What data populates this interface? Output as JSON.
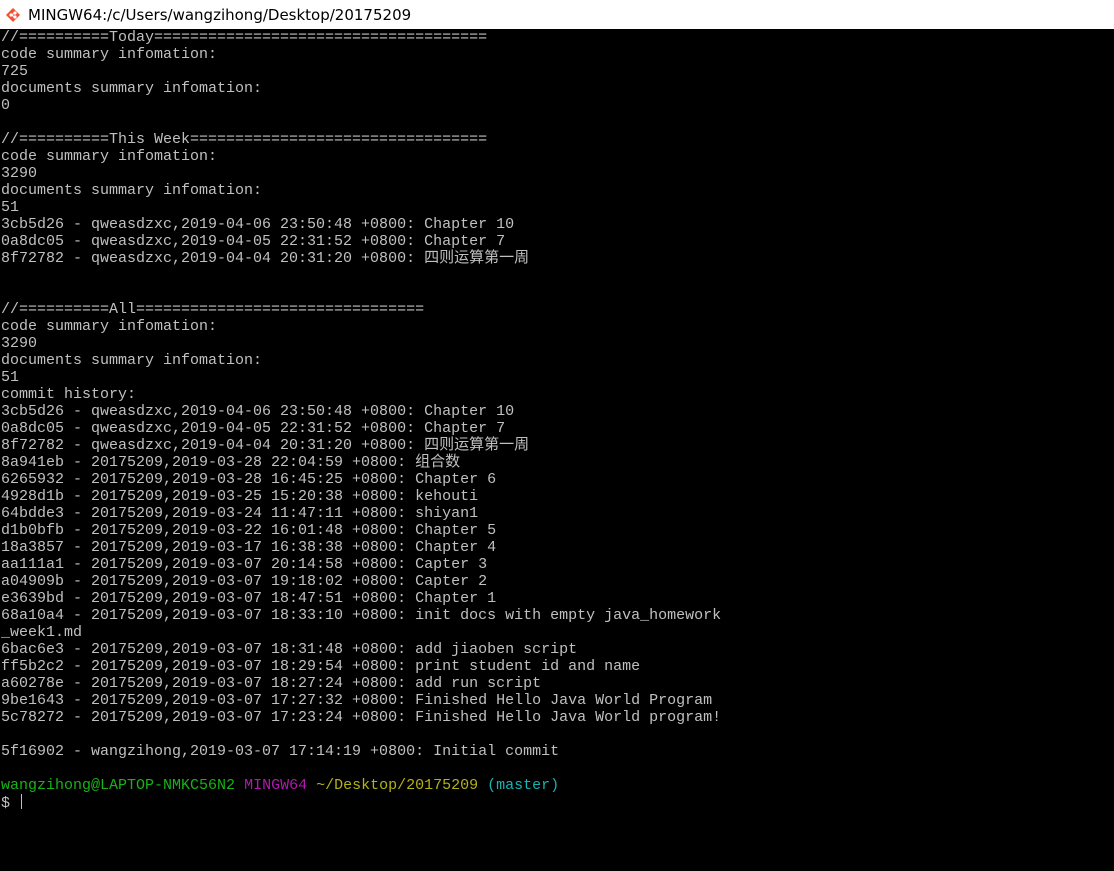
{
  "window": {
    "title": "MINGW64:/c/Users/wangzihong/Desktop/20175209",
    "icon": "git-bash-icon"
  },
  "terminal": {
    "lines": [
      "//==========Today=====================================",
      "code summary infomation:",
      "725",
      "documents summary infomation:",
      "0",
      "",
      "//==========This Week=================================",
      "code summary infomation:",
      "3290",
      "documents summary infomation:",
      "51",
      "3cb5d26 - qweasdzxc,2019-04-06 23:50:48 +0800: Chapter 10",
      "0a8dc05 - qweasdzxc,2019-04-05 22:31:52 +0800: Chapter 7",
      "8f72782 - qweasdzxc,2019-04-04 20:31:20 +0800: 四则运算第一周",
      "",
      "",
      "//==========All================================",
      "code summary infomation:",
      "3290",
      "documents summary infomation:",
      "51",
      "commit history:",
      "3cb5d26 - qweasdzxc,2019-04-06 23:50:48 +0800: Chapter 10",
      "0a8dc05 - qweasdzxc,2019-04-05 22:31:52 +0800: Chapter 7",
      "8f72782 - qweasdzxc,2019-04-04 20:31:20 +0800: 四则运算第一周",
      "8a941eb - 20175209,2019-03-28 22:04:59 +0800: 组合数",
      "6265932 - 20175209,2019-03-28 16:45:25 +0800: Chapter 6",
      "4928d1b - 20175209,2019-03-25 15:20:38 +0800: kehouti",
      "64bdde3 - 20175209,2019-03-24 11:47:11 +0800: shiyan1",
      "d1b0bfb - 20175209,2019-03-22 16:01:48 +0800: Chapter 5",
      "18a3857 - 20175209,2019-03-17 16:38:38 +0800: Chapter 4",
      "aa111a1 - 20175209,2019-03-07 20:14:58 +0800: Capter 3",
      "a04909b - 20175209,2019-03-07 19:18:02 +0800: Capter 2",
      "e3639bd - 20175209,2019-03-07 18:47:51 +0800: Chapter 1",
      "68a10a4 - 20175209,2019-03-07 18:33:10 +0800: init docs with empty java_homework",
      "_week1.md",
      "6bac6e3 - 20175209,2019-03-07 18:31:48 +0800: add jiaoben script",
      "ff5b2c2 - 20175209,2019-03-07 18:29:54 +0800: print student id and name",
      "a60278e - 20175209,2019-03-07 18:27:24 +0800: add run script",
      "9be1643 - 20175209,2019-03-07 17:27:32 +0800: Finished Hello Java World Program",
      "5c78272 - 20175209,2019-03-07 17:23:24 +0800: Finished Hello Java World program!",
      "",
      "5f16902 - wangzihong,2019-03-07 17:14:19 +0800: Initial commit",
      ""
    ],
    "prompt": {
      "user_host": "wangzihong@LAPTOP-NMKC56N2",
      "system": "MINGW64",
      "path": "~/Desktop/20175209",
      "branch": "(master)",
      "symbol": "$"
    },
    "colors": {
      "background": "#000000",
      "text": "#c0c0c0",
      "user_host": "#18b218",
      "system": "#b218b2",
      "path": "#b2b218",
      "branch": "#18b2b2"
    }
  }
}
